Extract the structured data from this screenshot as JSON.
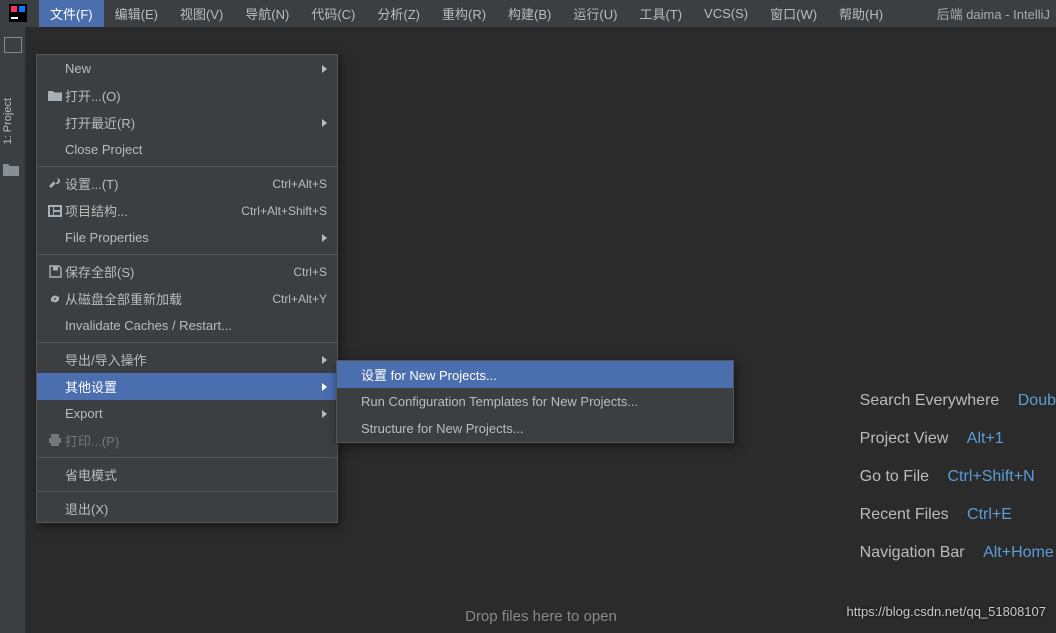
{
  "menubar": {
    "items": [
      "文件(F)",
      "编辑(E)",
      "视图(V)",
      "导航(N)",
      "代码(C)",
      "分析(Z)",
      "重构(R)",
      "构建(B)",
      "运行(U)",
      "工具(T)",
      "VCS(S)",
      "窗口(W)",
      "帮助(H)"
    ],
    "title": "后端 daima - IntelliJ"
  },
  "sidebar": {
    "project_label": "1: Project"
  },
  "file_menu": {
    "new": "New",
    "open": "打开...(O)",
    "open_recent": "打开最近(R)",
    "close_project": "Close Project",
    "settings": "设置...(T)",
    "settings_shortcut": "Ctrl+Alt+S",
    "project_structure": "项目结构...",
    "project_structure_shortcut": "Ctrl+Alt+Shift+S",
    "file_properties": "File Properties",
    "save_all": "保存全部(S)",
    "save_all_shortcut": "Ctrl+S",
    "reload": "从磁盘全部重新加载",
    "reload_shortcut": "Ctrl+Alt+Y",
    "invalidate": "Invalidate Caches / Restart...",
    "import_export": "导出/导入操作",
    "other_settings": "其他设置",
    "export": "Export",
    "print": "打印...(P)",
    "power_save": "省电模式",
    "exit": "退出(X)"
  },
  "submenu": {
    "settings_new": "设置 for New Projects...",
    "run_templates": "Run Configuration Templates for New Projects...",
    "structure_new": "Structure for New Projects..."
  },
  "tips": {
    "r1_label": "Search Everywhere",
    "r1_shortcut": "Doub",
    "r2_label": "Project View",
    "r2_shortcut": "Alt+1",
    "r3_label": "Go to File",
    "r3_shortcut": "Ctrl+Shift+N",
    "r4_label": "Recent Files",
    "r4_shortcut": "Ctrl+E",
    "r5_label": "Navigation Bar",
    "r5_shortcut": "Alt+Home"
  },
  "drop_hint": "Drop files here to open",
  "watermark": "https://blog.csdn.net/qq_51808107"
}
